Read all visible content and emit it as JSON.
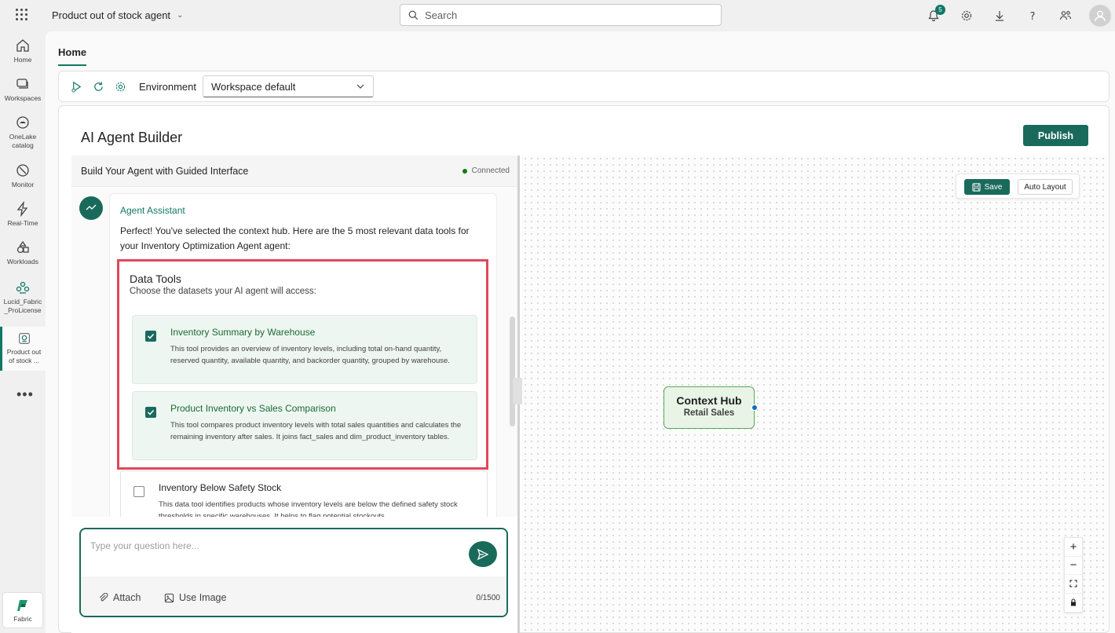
{
  "topbar": {
    "app_title": "Product out of stock agent",
    "search_placeholder": "Search",
    "notification_count": "5"
  },
  "leftnav": {
    "items": [
      {
        "label": "Home",
        "icon": "home-icon"
      },
      {
        "label": "Workspaces",
        "icon": "workspaces-icon"
      },
      {
        "label": "OneLake catalog",
        "icon": "onelake-icon"
      },
      {
        "label": "Monitor",
        "icon": "monitor-icon"
      },
      {
        "label": "Real-Time",
        "icon": "realtime-icon"
      },
      {
        "label": "Workloads",
        "icon": "workloads-icon"
      },
      {
        "label": "Lucid_Fabric_ProLicense",
        "icon": "workspace-icon"
      },
      {
        "label": "Product out of stock ...",
        "icon": "agent-icon"
      }
    ],
    "more": "•••",
    "fabric_label": "Fabric"
  },
  "main": {
    "tab_home": "Home",
    "environment_label": "Environment",
    "environment_value": "Workspace default"
  },
  "builder": {
    "title": "AI Agent Builder",
    "publish_label": "Publish",
    "panel_title": "Build Your Agent with Guided Interface",
    "status": "Connected",
    "assistant_name": "Agent Assistant",
    "assistant_message": "Perfect! You've selected the context hub. Here are the 5 most relevant data tools for your Inventory Optimization Agent agent:",
    "data_tools_title": "Data Tools",
    "data_tools_subtitle": "Choose the datasets your AI agent will access:",
    "tools": [
      {
        "name": "Inventory Summary by Warehouse",
        "description": "This tool provides an overview of inventory levels, including total on-hand quantity, reserved quantity, available quantity, and backorder quantity, grouped by warehouse.",
        "checked": true
      },
      {
        "name": "Product Inventory vs Sales Comparison",
        "description": "This tool compares product inventory levels with total sales quantities and calculates the remaining inventory after sales. It joins fact_sales and dim_product_inventory tables.",
        "checked": true
      },
      {
        "name": "Inventory Below Safety Stock",
        "description": "This data tool identifies products whose inventory levels are below the defined safety stock thresholds in specific warehouses. It helps to flag potential stockouts.",
        "checked": false
      }
    ],
    "input_placeholder": "Type your question here...",
    "attach_label": "Attach",
    "use_image_label": "Use Image",
    "char_counter": "0/1500"
  },
  "canvas": {
    "save_label": "Save",
    "auto_layout_label": "Auto Layout",
    "node_title": "Context Hub",
    "node_subtitle": "Retail Sales",
    "zoom_in": "+",
    "zoom_out": "−"
  },
  "colors": {
    "accent": "#1a6a5c",
    "highlight_border": "#e0475a",
    "node_fill": "#e8f5e6"
  }
}
